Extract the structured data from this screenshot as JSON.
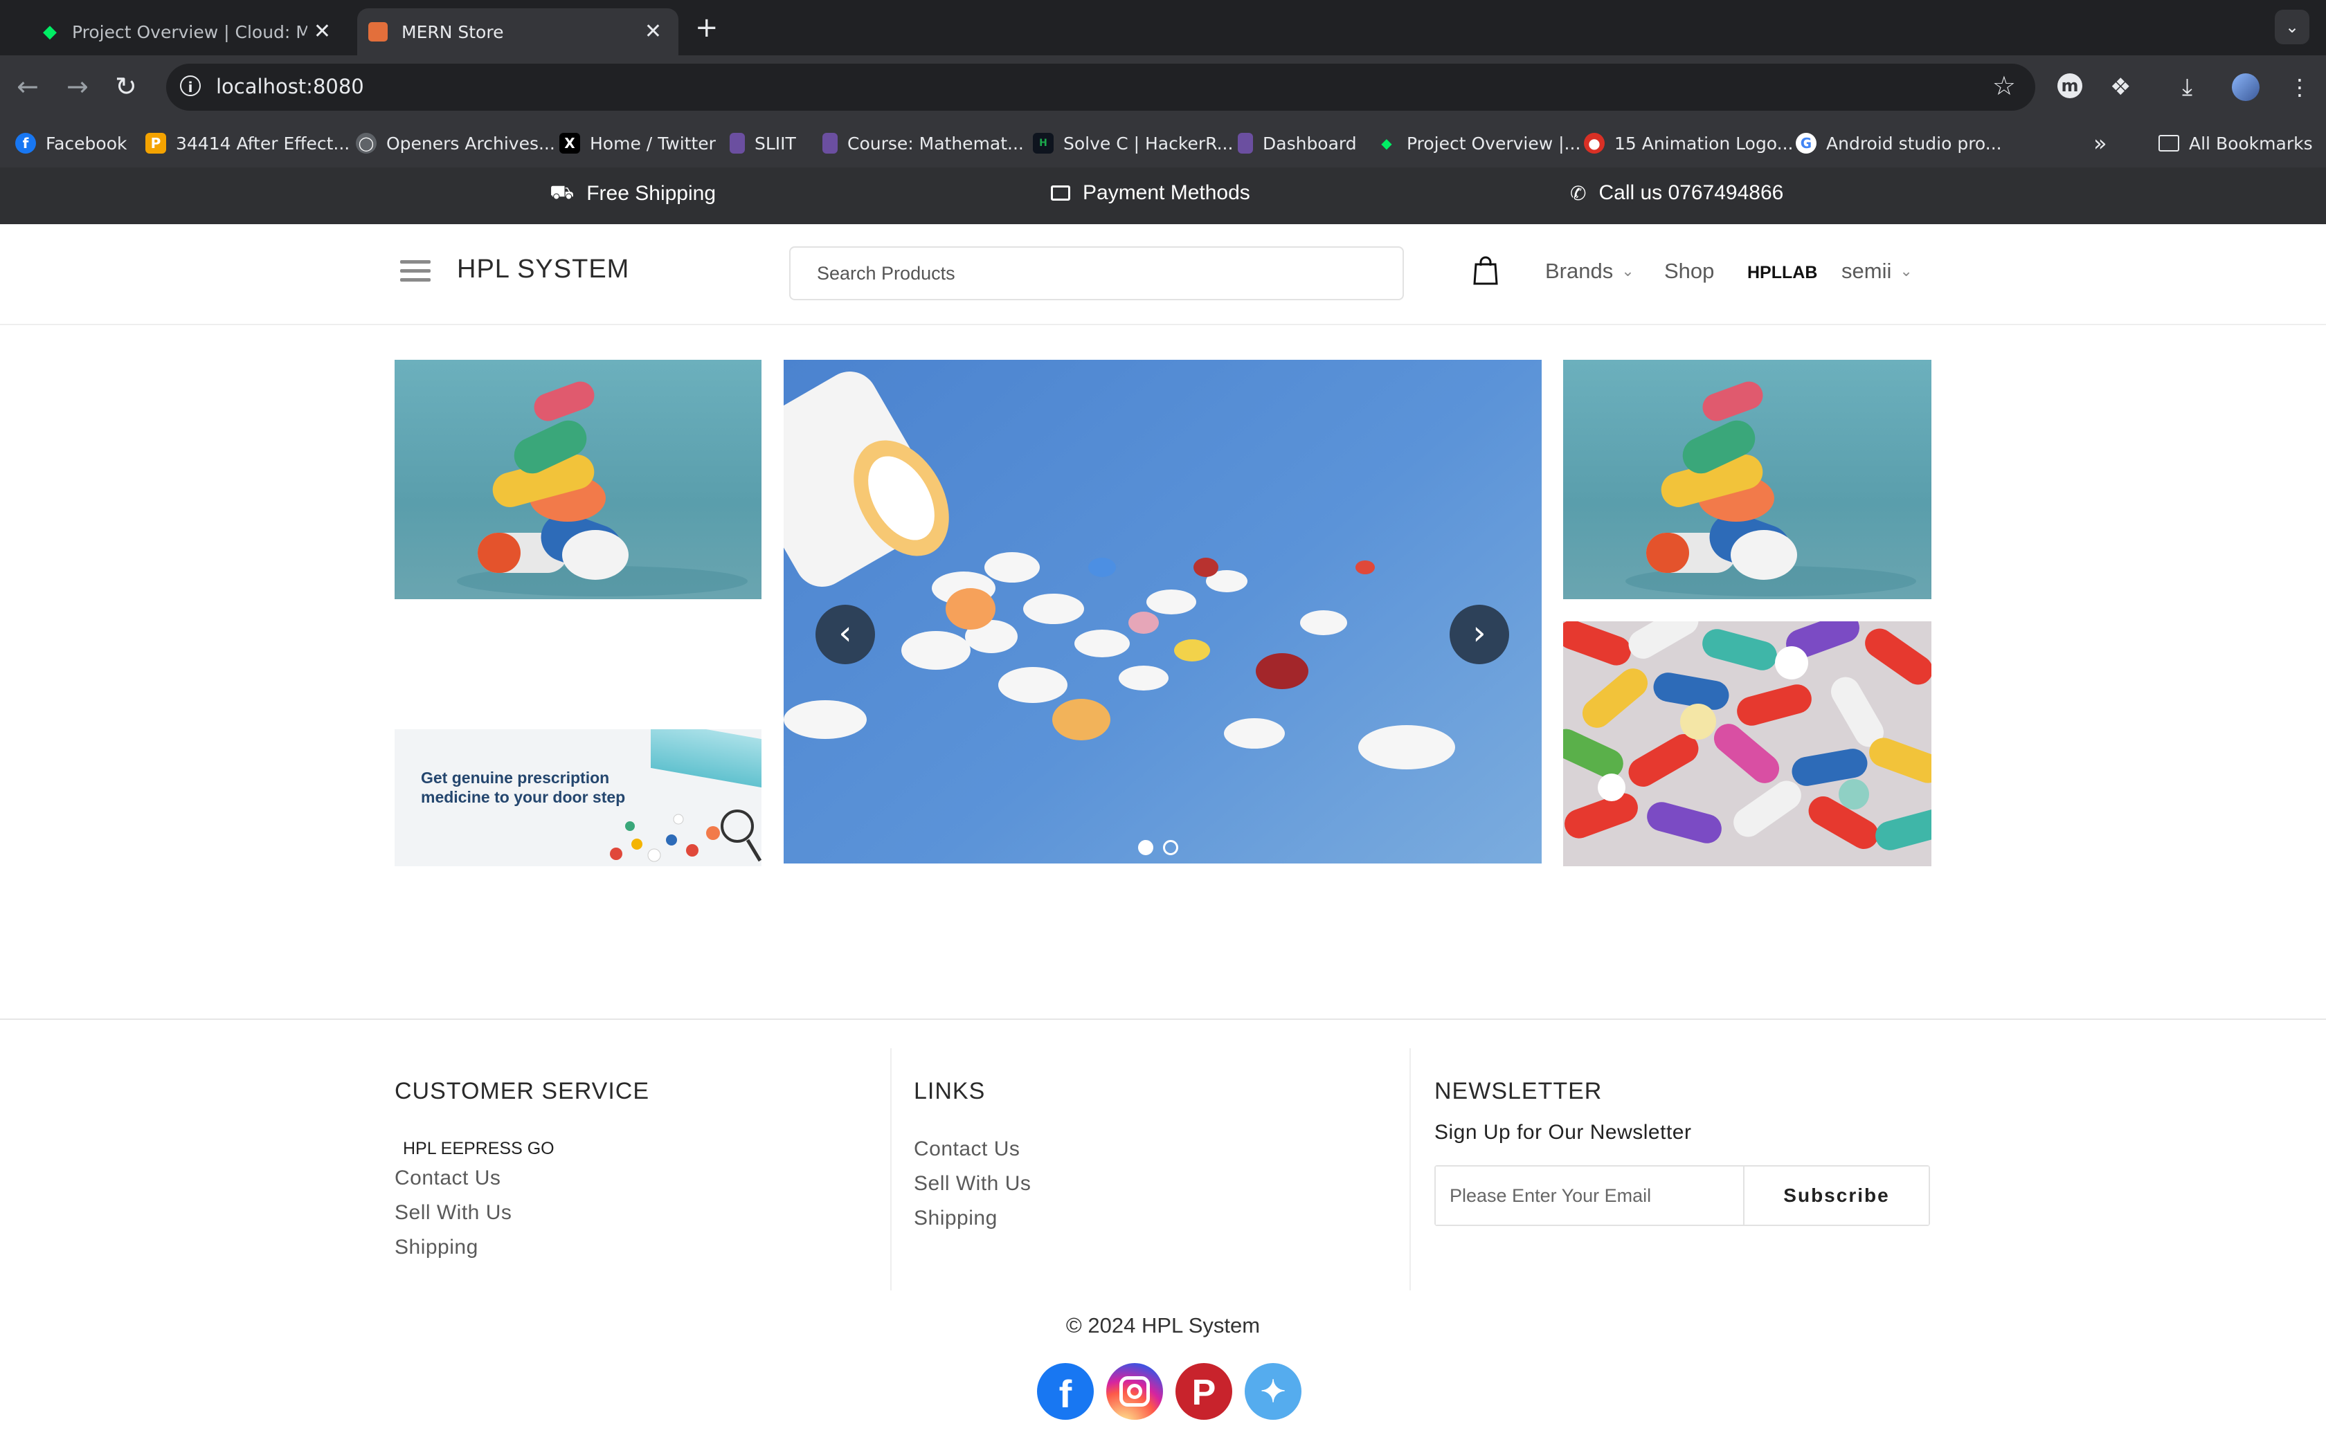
{
  "browser": {
    "tabs": [
      {
        "title": "Project Overview | Cloud: Mo",
        "active": false
      },
      {
        "title": "MERN Store",
        "active": true
      }
    ],
    "new_tab_icon": "plus-icon",
    "url": "localhost:8080",
    "bookmarks": [
      {
        "label": "Facebook",
        "icon": "facebook-icon",
        "color": "#1877f2"
      },
      {
        "label": "34414 After Effect...",
        "icon": "p-icon",
        "color": "#f4a300"
      },
      {
        "label": "Openers Archives...",
        "icon": "globe-icon",
        "color": "#5f6368"
      },
      {
        "label": "Home / Twitter",
        "icon": "x-icon",
        "color": "#000000"
      },
      {
        "label": "SLIIT",
        "icon": "shield-icon",
        "color": "#6b4fa0"
      },
      {
        "label": "Course: Mathemat...",
        "icon": "shield-icon",
        "color": "#6b4fa0"
      },
      {
        "label": "Solve C | HackerR...",
        "icon": "hackerrank-icon",
        "color": "#1ba94c"
      },
      {
        "label": "Dashboard",
        "icon": "shield-icon",
        "color": "#6b4fa0"
      },
      {
        "label": "Project Overview |...",
        "icon": "leaf-icon",
        "color": "#00ed64"
      },
      {
        "label": "15 Animation Logo...",
        "icon": "logo-icon",
        "color": "#d93025"
      },
      {
        "label": "Android studio pro...",
        "icon": "google-icon",
        "color": "#4285f4"
      }
    ],
    "all_bookmarks": "All Bookmarks"
  },
  "topbar": {
    "free_shipping": "Free Shipping",
    "payment_methods": "Payment Methods",
    "call_us": "Call us 0767494866"
  },
  "header": {
    "brand": "HPL SYSTEM",
    "search_placeholder": "Search Products",
    "nav": {
      "brands": "Brands",
      "shop": "Shop",
      "hpllab": "HPLLAB",
      "user": "semii"
    }
  },
  "banners": {
    "promo_text": "Get genuine prescription medicine to your door step",
    "carousel_slides": 2,
    "active_slide": 1
  },
  "footer": {
    "customer_service": {
      "title": "CUSTOMER SERVICE",
      "subtitle": "HPL EEPRESS GO",
      "links": [
        "Contact Us",
        "Sell With Us",
        "Shipping"
      ]
    },
    "links": {
      "title": "LINKS",
      "items": [
        "Contact Us",
        "Sell With Us",
        "Shipping"
      ]
    },
    "newsletter": {
      "title": "NEWSLETTER",
      "subtitle": "Sign Up for Our Newsletter",
      "placeholder": "Please Enter Your Email",
      "button": "Subscribe"
    },
    "copyright": "© 2024 HPL System",
    "social": [
      {
        "name": "facebook-icon",
        "color": "#1877f2"
      },
      {
        "name": "instagram-icon",
        "color": "#e1306c"
      },
      {
        "name": "pinterest-icon",
        "color": "#c8232c"
      },
      {
        "name": "twitter-icon",
        "color": "#55acee"
      }
    ]
  }
}
